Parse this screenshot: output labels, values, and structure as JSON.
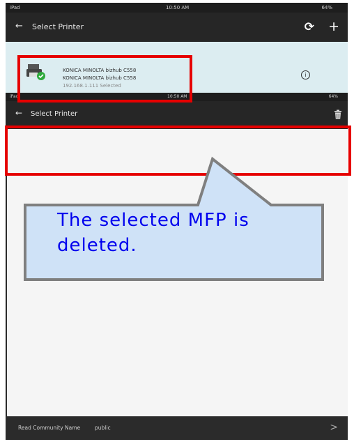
{
  "before_screen": {
    "status_bar": {
      "left": "iPad",
      "center": "10:50 AM",
      "right": "64%"
    },
    "app_bar": {
      "title": "Select Printer"
    },
    "printer": {
      "name_line_1": "KONICA MINOLTA bizhub C558",
      "name_line_2": "KONICA MINOLTA bizhub C558",
      "address_line": "192.168.1.111  Selected"
    }
  },
  "after_screen": {
    "status_bar": {
      "left": "iPad",
      "center": "10:50 AM",
      "right": "64%"
    },
    "app_bar": {
      "title": "Select Printer"
    },
    "bottom_bar": {
      "label": "Read Community Name",
      "value": "public"
    }
  },
  "callout": {
    "text_line_1": "The selected MFP is",
    "text_line_2": "deleted."
  },
  "colors": {
    "highlight": "#e60000",
    "callout_fill": "#cfe2f7",
    "callout_border": "#7f7f7f",
    "callout_text": "#0000ee"
  }
}
